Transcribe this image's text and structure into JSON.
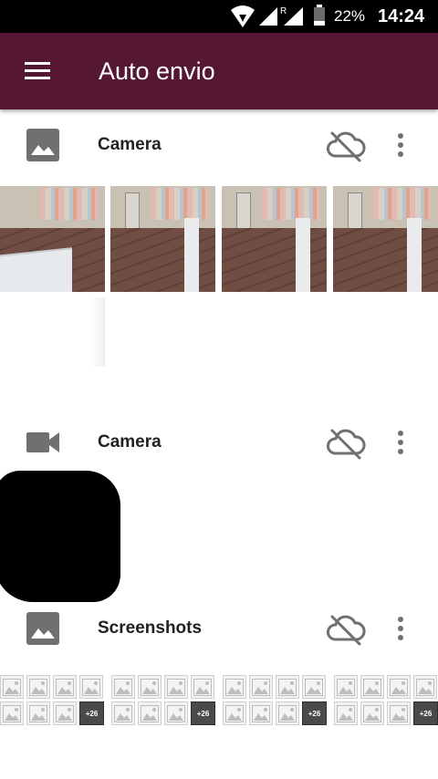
{
  "status_bar": {
    "battery_percent": "22%",
    "time": "14:24"
  },
  "app_bar": {
    "title": "Auto envio"
  },
  "folders": [
    {
      "name": "Camera",
      "type_icon": "photo-icon",
      "sync_icon": "cloud-off-icon",
      "menu_icon": "more-vert-icon"
    },
    {
      "name": "Camera",
      "type_icon": "videocam-icon",
      "sync_icon": "cloud-off-icon",
      "menu_icon": "more-vert-icon"
    },
    {
      "name": "Screenshots",
      "type_icon": "photo-icon",
      "sync_icon": "cloud-off-icon",
      "menu_icon": "more-vert-icon"
    }
  ],
  "screenshots": {
    "more_count_label": "+26"
  },
  "colors": {
    "app_bar": "#561732",
    "icon_gray": "#707070"
  }
}
